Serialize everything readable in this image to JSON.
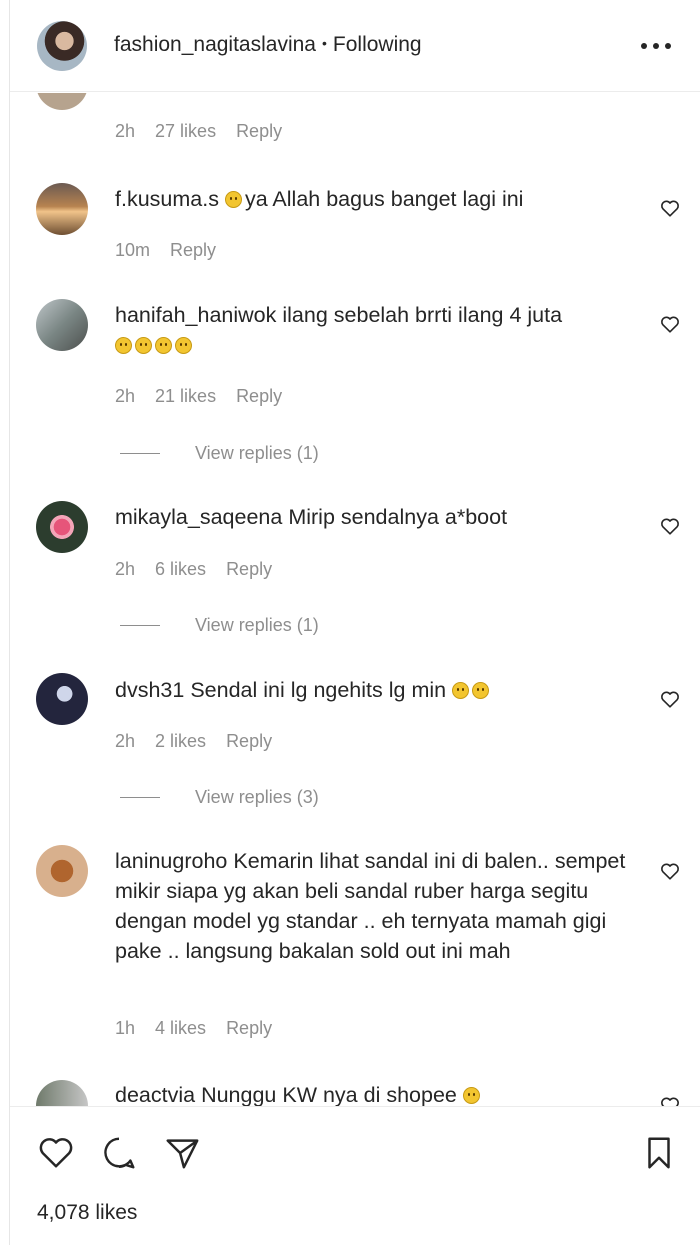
{
  "header": {
    "username": "fashion_nagitaslavina",
    "separator": "•",
    "follow_status": "Following"
  },
  "comments": [
    {
      "username": "",
      "text": "",
      "time": "2h",
      "likes": "27 likes",
      "reply": "Reply"
    },
    {
      "username": "f.kusuma.s",
      "text": "ya Allah bagus banget lagi ini",
      "time": "10m",
      "likes": "",
      "reply": "Reply"
    },
    {
      "username": "hanifah_haniwok",
      "text": "ilang sebelah brrti ilang 4 juta",
      "time": "2h",
      "likes": "21 likes",
      "reply": "Reply",
      "view_replies": "View replies (1)"
    },
    {
      "username": "mikayla_saqeena",
      "text": "Mirip sendalnya a*boot",
      "time": "2h",
      "likes": "6 likes",
      "reply": "Reply",
      "view_replies": "View replies (1)"
    },
    {
      "username": "dvsh31",
      "text": "Sendal ini lg ngehits lg min",
      "time": "2h",
      "likes": "2 likes",
      "reply": "Reply",
      "view_replies": "View replies (3)"
    },
    {
      "username": "laninugroho",
      "text": "Kemarin lihat sandal ini di balen.. sempet mikir siapa yg akan beli sandal ruber harga segitu dengan model yg standar .. eh ternyata mamah gigi pake .. langsung bakalan sold out ini mah",
      "time": "1h",
      "likes": "4 likes",
      "reply": "Reply"
    },
    {
      "username": "deactvia",
      "text": "Nunggu KW nya di shopee"
    }
  ],
  "footer": {
    "likes_count": "4,078 likes"
  },
  "icons": {
    "more": "more-options-icon",
    "like": "heart-icon",
    "comment": "comment-icon",
    "share": "share-icon",
    "save": "bookmark-icon",
    "comment_like": "heart-outline-icon",
    "emoji": "emoji-icon"
  },
  "colors": {
    "text": "#262626",
    "secondary": "#8e8e8e",
    "divider": "#ececec"
  }
}
